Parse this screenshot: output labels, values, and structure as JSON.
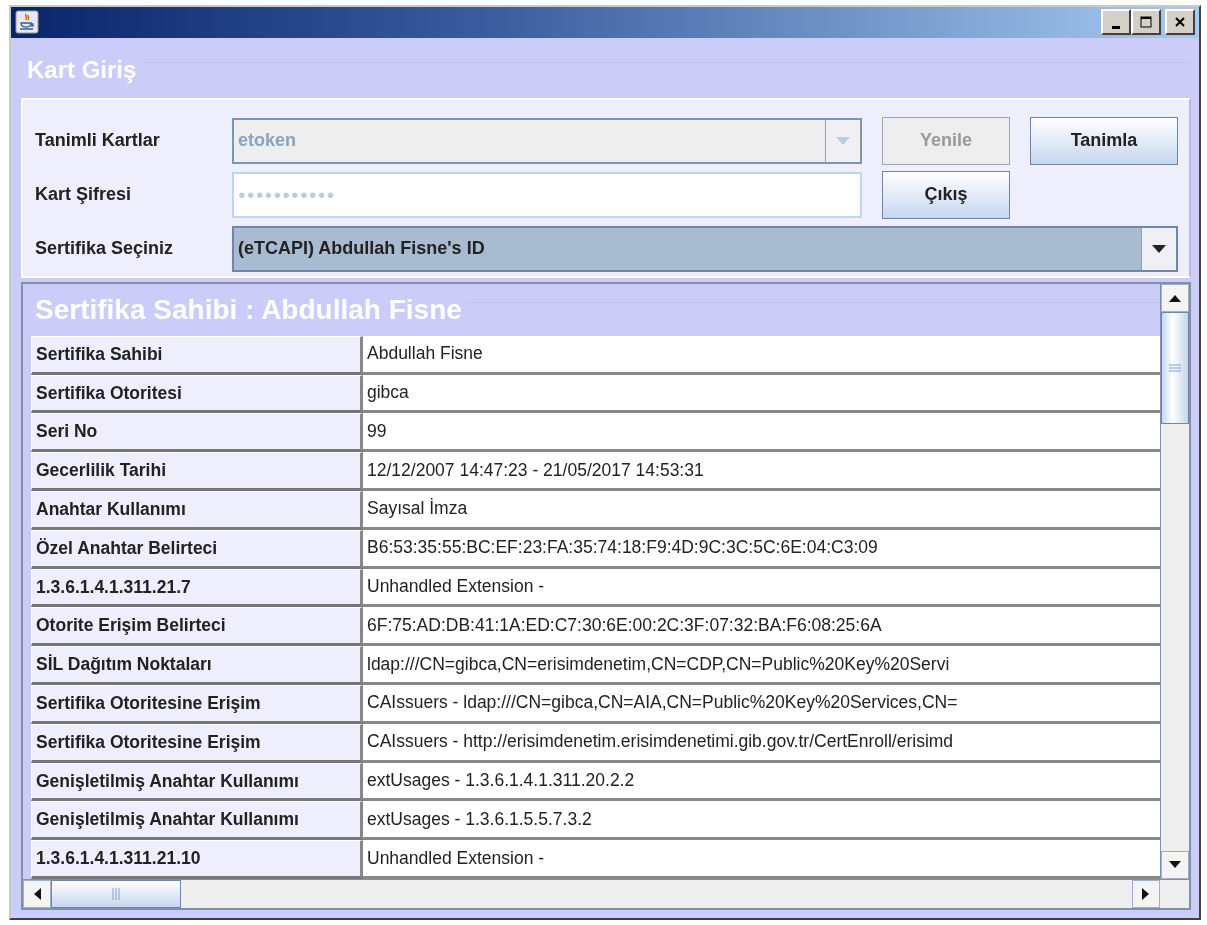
{
  "group_title": "Kart Giriş",
  "form": {
    "cards_label": "Tanimli Kartlar",
    "cards_combo": {
      "value": "etoken",
      "disabled": true
    },
    "password_label": "Kart Şifresi",
    "password_field": {
      "value": "●●●●●●●●●●●"
    },
    "cert_label": "Sertifika Seçiniz",
    "cert_combo": {
      "value": "(eTCAPI) Abdullah Fisne's  ID",
      "disabled": false
    }
  },
  "buttons": [
    {
      "label": "Yenile",
      "disabled": true
    },
    {
      "label": "Tanimla",
      "disabled": false
    },
    {
      "label": "Çıkış",
      "disabled": false
    }
  ],
  "details_title": "Sertifika Sahibi : Abdullah Fisne",
  "table": {
    "rows": [
      {
        "label": "Sertifika Sahibi",
        "value": "Abdullah Fisne"
      },
      {
        "label": "Sertifika Otoritesi",
        "value": "gibca"
      },
      {
        "label": "Seri No",
        "value": "99"
      },
      {
        "label": "Gecerlilik Tarihi",
        "value": "12/12/2007 14:47:23 - 21/05/2017 14:53:31"
      },
      {
        "label": "Anahtar Kullanımı",
        "value": "Sayısal İmza"
      },
      {
        "label": "Özel Anahtar Belirteci",
        "value": "B6:53:35:55:BC:EF:23:FA:35:74:18:F9:4D:9C:3C:5C:6E:04:C3:09"
      },
      {
        "label": "1.3.6.1.4.1.311.21.7",
        "value": "Unhandled Extension -"
      },
      {
        "label": "Otorite Erişim Belirteci",
        "value": "6F:75:AD:DB:41:1A:ED:C7:30:6E:00:2C:3F:07:32:BA:F6:08:25:6A"
      },
      {
        "label": "SİL Dağıtım Noktaları",
        "value": "ldap:///CN=gibca,CN=erisimdenetim,CN=CDP,CN=Public%20Key%20Servi"
      },
      {
        "label": "Sertifika Otoritesine Erişim",
        "value": "CAIssuers - ldap:///CN=gibca,CN=AIA,CN=Public%20Key%20Services,CN="
      },
      {
        "label": "Sertifika Otoritesine Erişim",
        "value": "CAIssuers - http://erisimdenetim.erisimdenetimi.gib.gov.tr/CertEnroll/erisimd"
      },
      {
        "label": "Genişletilmiş Anahtar Kullanımı",
        "value": "extUsages - 1.3.6.1.4.1.311.20.2.2"
      },
      {
        "label": "Genişletilmiş Anahtar Kullanımı",
        "value": "extUsages - 1.3.6.1.5.5.7.3.2"
      },
      {
        "label": "1.3.6.1.4.1.311.21.10",
        "value": "Unhandled Extension -"
      }
    ]
  }
}
